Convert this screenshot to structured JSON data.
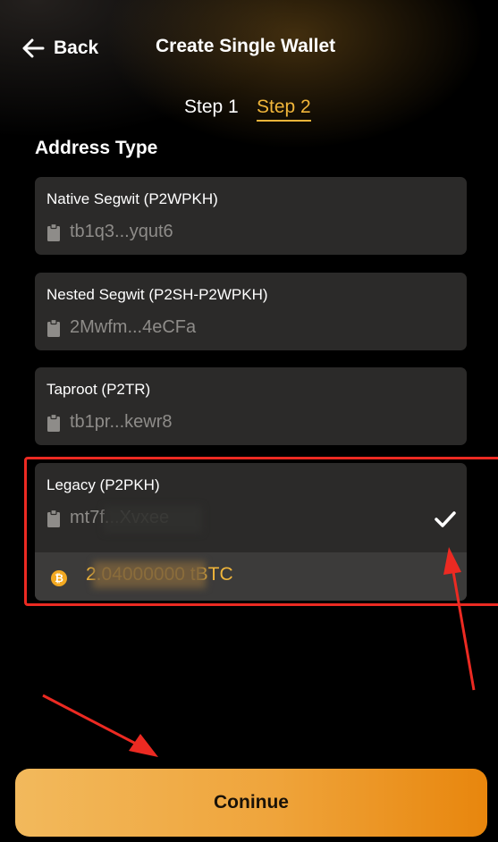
{
  "header": {
    "back_label": "Back",
    "title": "Create Single Wallet",
    "back_icon": "arrow-left-icon"
  },
  "steps": {
    "step1": "Step 1",
    "step2": "Step 2",
    "active_step": 2,
    "active_color": "#f0b53a"
  },
  "address_type": {
    "title": "Address Type",
    "options": [
      {
        "name": "Native Segwit (P2WPKH)",
        "address": "tb1q3...yqut6",
        "icon": "clipboard-icon"
      },
      {
        "name": "Nested Segwit (P2SH-P2WPKH)",
        "address": "2Mwfm...4eCFa",
        "icon": "clipboard-icon"
      },
      {
        "name": "Taproot (P2TR)",
        "address": "tb1pr...kewr8",
        "icon": "clipboard-icon"
      },
      {
        "name": "Legacy (P2PKH)",
        "address": "mt7f...Xvxee",
        "icon": "clipboard-icon",
        "selected": true,
        "check_icon": "checkmark-icon",
        "balance": "2.04000000 tBTC",
        "coin_icon": "bitcoin-icon"
      }
    ]
  },
  "footer": {
    "continue_label": "Coninue"
  },
  "colors": {
    "accent": "#f0b53a",
    "card_bg": "#2b2a29",
    "annotation_red": "#ec2a22"
  }
}
